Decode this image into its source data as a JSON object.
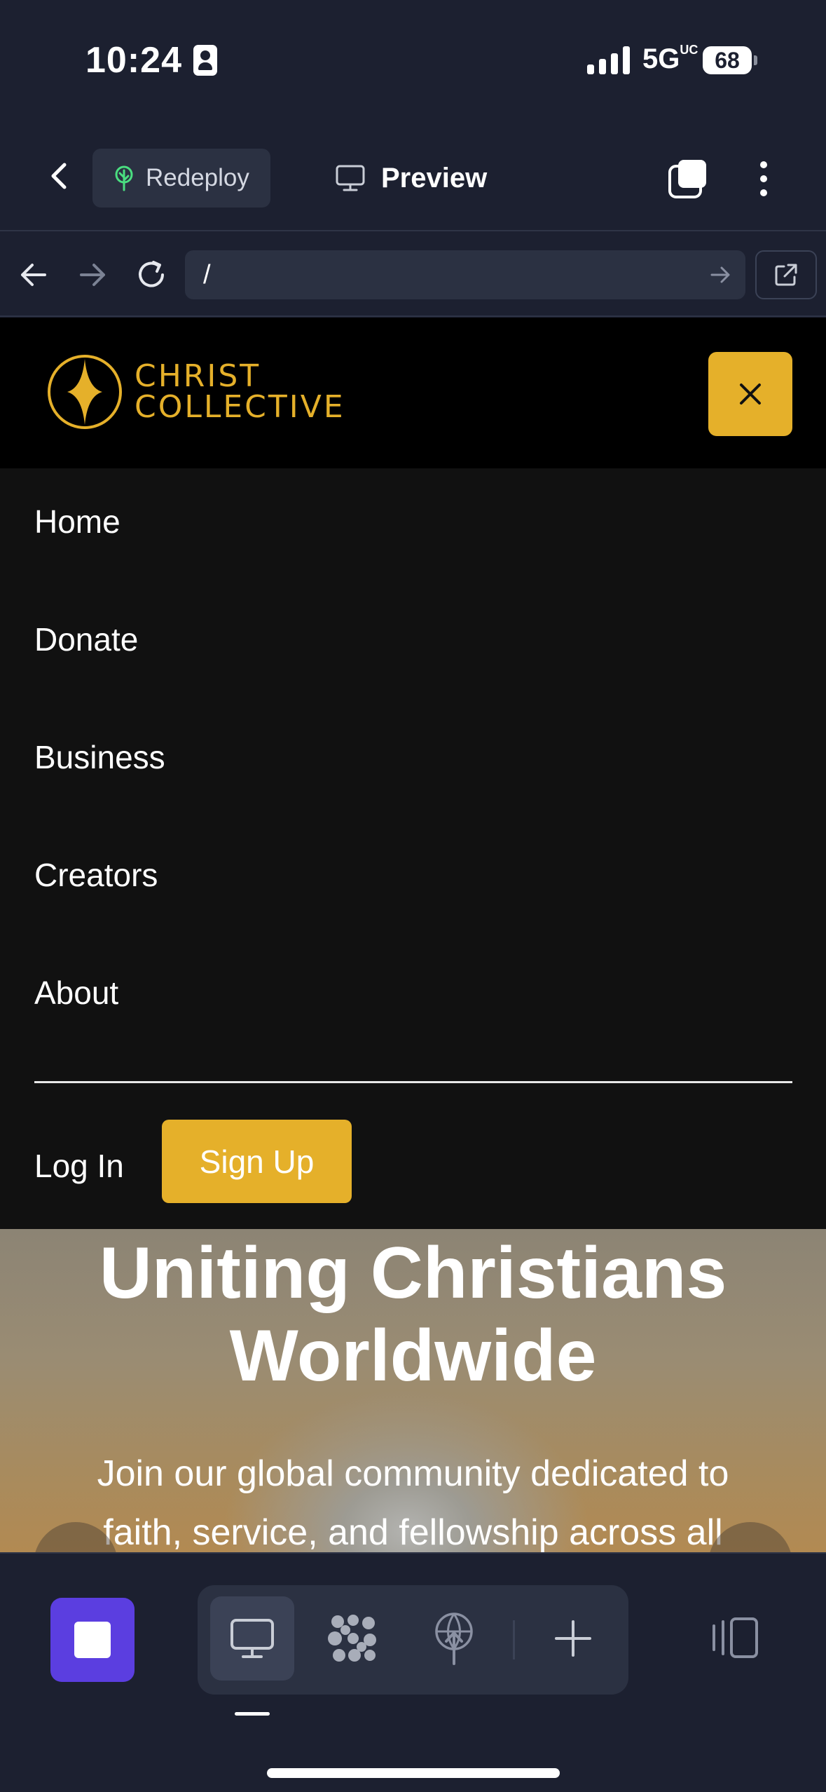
{
  "status_bar": {
    "time": "10:24",
    "network": "5G",
    "network_suffix": "UC",
    "battery": "68"
  },
  "toolbar": {
    "redeploy_label": "Redeploy",
    "preview_label": "Preview"
  },
  "browser": {
    "url": "/"
  },
  "site": {
    "brand_line1": "CHRIST",
    "brand_line2": "COLLECTIVE",
    "nav": [
      "Home",
      "Donate",
      "Business",
      "Creators",
      "About"
    ],
    "login_label": "Log In",
    "signup_label": "Sign Up",
    "hero_title_line1": "Uniting Christians",
    "hero_title_line2": "Worldwide",
    "hero_sub_line1": "Join our global community dedicated to",
    "hero_sub_line2": "faith, service, and fellowship across all"
  },
  "colors": {
    "accent": "#e5b02a",
    "app_bg": "#1c2030",
    "stop_button": "#5b3ee0"
  },
  "icons": {
    "toolbar": [
      "chevron-left-icon",
      "sprout-icon",
      "monitor-icon",
      "tabs-icon",
      "more-vertical-icon"
    ],
    "browser": [
      "arrow-left-icon",
      "arrow-right-icon",
      "reload-icon",
      "arrow-right-icon",
      "external-link-icon"
    ],
    "bottom": [
      "stop-icon",
      "monitor-icon",
      "cluster-icon",
      "globe-deploy-icon",
      "plus-icon",
      "panel-toggle-icon"
    ]
  }
}
